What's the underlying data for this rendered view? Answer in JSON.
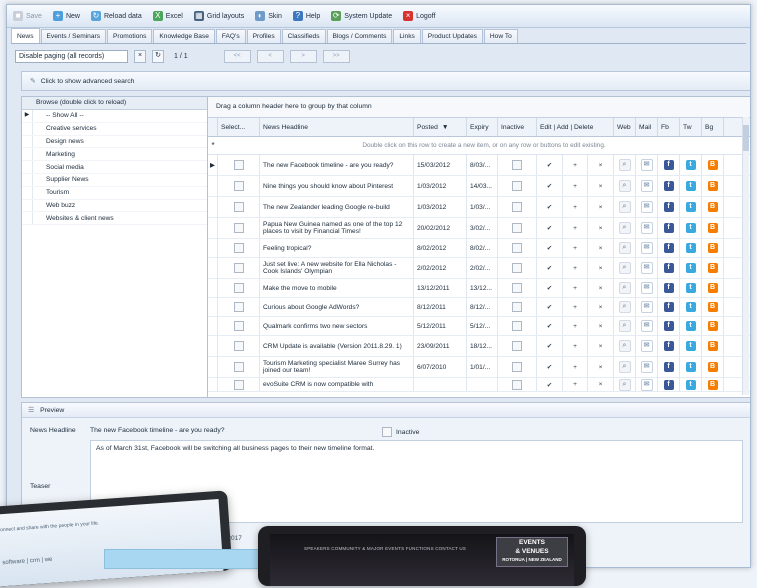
{
  "toolbar": {
    "items": [
      {
        "label": "Save",
        "icon": "save-icon",
        "disabled": true
      },
      {
        "label": "New",
        "icon": "new-icon",
        "disabled": false
      },
      {
        "label": "Reload data",
        "icon": "reload-icon",
        "disabled": false
      },
      {
        "label": "Excel",
        "icon": "excel-icon",
        "disabled": false
      },
      {
        "label": "Grid layouts",
        "icon": "grid-layouts-icon",
        "disabled": false
      },
      {
        "label": "Skin",
        "icon": "skin-icon",
        "disabled": false
      },
      {
        "label": "Help",
        "icon": "help-icon",
        "disabled": false
      },
      {
        "label": "System Update",
        "icon": "system-update-icon",
        "disabled": false
      },
      {
        "label": "Logoff",
        "icon": "logoff-icon",
        "disabled": false
      }
    ]
  },
  "tabs": [
    "News",
    "Events / Seminars",
    "Promotions",
    "Knowledge Base",
    "FAQ's",
    "Profiles",
    "Classifieds",
    "Blogs / Comments",
    "Links",
    "Product Updates",
    "How To"
  ],
  "active_tab": "News",
  "paging": {
    "selected": "Disable paging (all records)",
    "page_text": "1 / 1",
    "buttons": [
      "<<",
      "<",
      ">",
      ">>"
    ]
  },
  "advanced_search": "Click to show advanced search",
  "browse": {
    "header": "Browse (double click to reload)",
    "items": [
      "-- Show All --",
      "Creative services",
      "Design news",
      "Marketing",
      "Social media",
      "Supplier News",
      "Tourism",
      "Web buzz",
      "Websites & client news"
    ]
  },
  "grid": {
    "group_hint": "Drag a column header here to group by that column",
    "headers": {
      "select": "Select...",
      "headline": "News Headline",
      "posted": "Posted",
      "expiry": "Expiry",
      "inactive": "Inactive",
      "edit_add_delete": "Edit | Add | Delete",
      "web": "Web",
      "mail": "Mail",
      "fb": "Fb",
      "tw": "Tw",
      "bg": "Bg"
    },
    "new_row_hint": "Double click on this row to create a new item, or on any row or buttons to edit existing.",
    "rows": [
      {
        "headline": "The new Facebook timeline - are you ready?",
        "posted": "15/03/2012",
        "expiry": "8/03/..."
      },
      {
        "headline": "Nine things you should know about Pinterest",
        "posted": "1/03/2012",
        "expiry": "14/03..."
      },
      {
        "headline": "The new Zealander leading Google re-build",
        "posted": "1/03/2012",
        "expiry": "1/03/..."
      },
      {
        "headline": "Papua New Guinea named as one of the top 12 places to visit by Financial Times!",
        "posted": "20/02/2012",
        "expiry": "3/02/..."
      },
      {
        "headline": "Feeling tropical?",
        "posted": "8/02/2012",
        "expiry": "8/02/..."
      },
      {
        "headline": "Just set live: A new website for Ella Nicholas - Cook Islands' Olympian",
        "posted": "2/02/2012",
        "expiry": "2/02/..."
      },
      {
        "headline": "Make the move to mobile",
        "posted": "13/12/2011",
        "expiry": "13/12..."
      },
      {
        "headline": "Curious about Google AdWords?",
        "posted": "8/12/2011",
        "expiry": "8/12/..."
      },
      {
        "headline": "Qualmark confirms two new sectors",
        "posted": "5/12/2011",
        "expiry": "5/12/..."
      },
      {
        "headline": "CRM Update is available (Version 2011.8.29. 1)",
        "posted": "23/09/2011",
        "expiry": "18/12..."
      },
      {
        "headline": "Tourism Marketing specialist Maree Surrey has joined our team!",
        "posted": "6/07/2010",
        "expiry": "1/01/..."
      },
      {
        "headline": "evoSuite CRM is now compatible with",
        "posted": "",
        "expiry": ""
      }
    ]
  },
  "preview": {
    "title": "Preview",
    "headline_label": "News Headline",
    "headline_value": "The new Facebook timeline - are you ready?",
    "inactive_label": "Inactive",
    "teaser_label": "Teaser",
    "teaser_text": "As of March 31st, Facebook will be switching all business pages to their new timeline format."
  },
  "device_left": {
    "lines": [
      "onnect and share with the people in your life.",
      "software | crm | we"
    ]
  },
  "device_right": {
    "menu": "SPEAKERS   COMMUNITY & MAJOR EVENTS   FUNCTIONS   CONTACT US",
    "badge_lines": [
      "EVENTS",
      "& VENUES",
      "ROTORUA | NEW ZEALAND"
    ]
  },
  "year_fragment": "0/2017",
  "colors": {
    "accent": "#2e6fb8",
    "facebook": "#3b5998",
    "twitter": "#39a9e0",
    "blogger": "#f57d00"
  }
}
